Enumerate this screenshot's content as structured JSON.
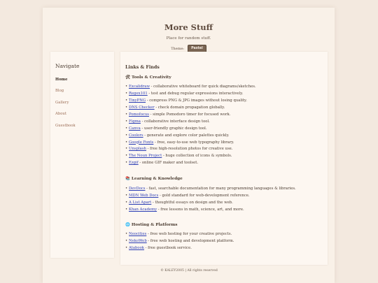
{
  "header": {
    "title": "More Stuff",
    "subtitle": "Place for random stuff.",
    "theme_label": "Theme:",
    "theme_button": "Pastel"
  },
  "sidebar": {
    "title": "Navigate",
    "items": [
      {
        "label": "Home",
        "active": true
      },
      {
        "label": "Blog",
        "active": false
      },
      {
        "label": "Gallery",
        "active": false
      },
      {
        "label": "About",
        "active": false
      },
      {
        "label": "Guestbook",
        "active": false
      }
    ]
  },
  "main": {
    "title": "Links & Finds",
    "sections": [
      {
        "icon": "toolbox-icon",
        "emoji": "🛠",
        "title": "Tools & Creativity",
        "items": [
          {
            "link": "Excalidraw",
            "desc": " - collaborative whiteboard for quick diagrams/sketches."
          },
          {
            "link": "Regex101",
            "desc": " - test and debug regular expressions interactively."
          },
          {
            "link": "TinyPNG",
            "desc": " - compress PNG & JPG images without losing quality."
          },
          {
            "link": "DNS Checker",
            "desc": " - check domain propagation globally."
          },
          {
            "link": "Pomofocus",
            "desc": " - simple Pomodoro timer for focused work."
          },
          {
            "link": "Figma",
            "desc": " - collaborative interface design tool."
          },
          {
            "link": "Canva",
            "desc": " - user-friendly graphic design tool."
          },
          {
            "link": "Coolors",
            "desc": " - generate and explore color palettes quickly."
          },
          {
            "link": "Google Fonts",
            "desc": " - free, easy-to-use web typography library."
          },
          {
            "link": "Unsplash",
            "desc": " - free high-resolution photos for creative use."
          },
          {
            "link": "The Noun Project",
            "desc": " - huge collection of icons & symbols."
          },
          {
            "link": "Ezgif",
            "desc": " - online GIF maker and toolset."
          }
        ]
      },
      {
        "icon": "books-icon",
        "emoji": "📚",
        "title": "Learning & Knowledge",
        "items": [
          {
            "link": "DevDocs",
            "desc": " - fast, searchable documentation for many programming languages & libraries."
          },
          {
            "link": "MDN Web Docs",
            "desc": " - gold standard for web-development reference."
          },
          {
            "link": "A List Apart",
            "desc": " - thoughtful essays on design and the web."
          },
          {
            "link": "Khan Academy",
            "desc": " - free lessons in math, science, art, and more."
          }
        ]
      },
      {
        "icon": "globe-icon",
        "emoji": "🌐",
        "title": "Hosting & Platforms",
        "items": [
          {
            "link": "Neocities",
            "desc": " - free web hosting for your creative projects."
          },
          {
            "link": "NekoWeb",
            "desc": " - free web hosting and development platform."
          },
          {
            "link": "Atabook",
            "desc": " - free guestbook service."
          }
        ]
      }
    ]
  },
  "footer": {
    "text": "© KALEY2005 | All rights reserved"
  },
  "colors": {
    "background": "#f3e9df",
    "page": "#f9f1e8",
    "card": "#fdf7f1",
    "link": "#2d3fb5",
    "nav_link": "#9c6e57",
    "button": "#7a6553"
  }
}
